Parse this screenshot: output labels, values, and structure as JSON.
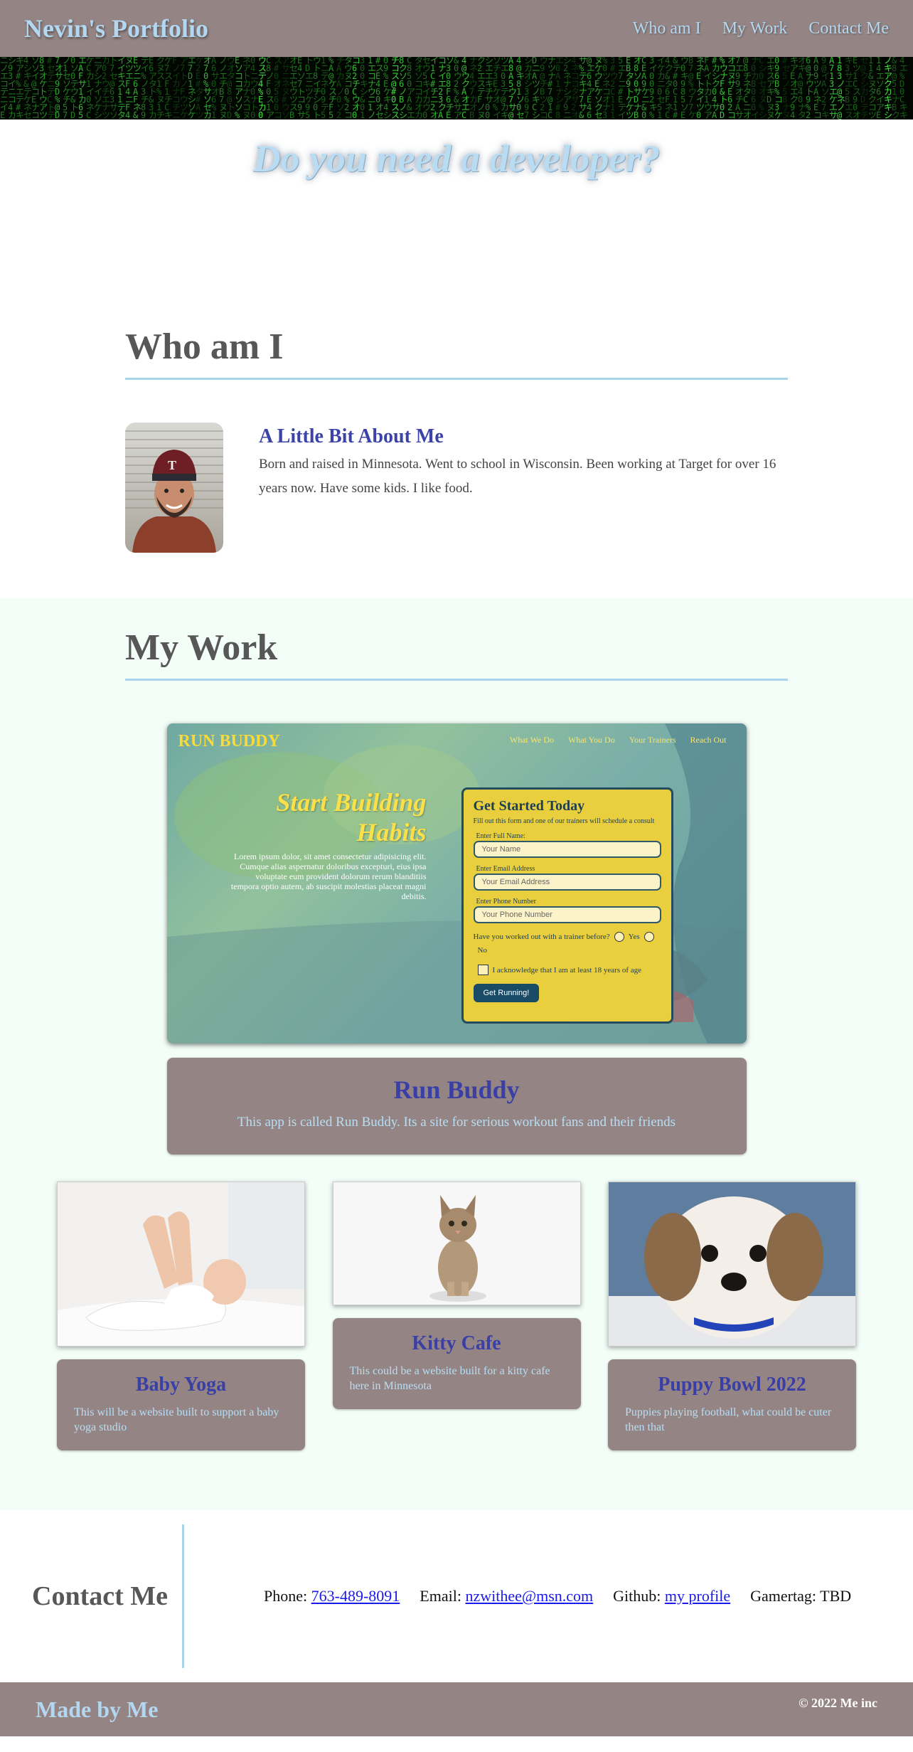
{
  "header": {
    "title": "Nevin's Portfolio",
    "nav": [
      "Who am I",
      "My Work",
      "Contact Me"
    ]
  },
  "hero": {
    "tagline": "Do you need a developer?"
  },
  "about": {
    "section_title": "Who am I",
    "heading": "A Little Bit About Me",
    "body": "Born and raised in Minnesota. Went to school in Wisconsin. Been working at Target for over 16 years now. Have some kids. I like food."
  },
  "work": {
    "section_title": "My Work",
    "featured": {
      "screenshot": {
        "logo": "RUN BUDDY",
        "nav": [
          "What We Do",
          "What You Do",
          "Your Trainers",
          "Reach Out"
        ],
        "headline": "Start Building Habits",
        "lorem": "Lorem ipsum dolor, sit amet consectetur adipisicing elit. Cumque alias aspernatur doloribus excepturi, eius ipsa voluptate eum provident dolorum rerum blanditiis tempora optio autem, ab suscipit molestias placeat magni debitis.",
        "form_title": "Get Started Today",
        "form_subtitle": "Fill out this form and one of our trainers will schedule a consult",
        "name_label": "Enter Full Name:",
        "name_placeholder": "Your Name",
        "email_label": "Enter Email Address",
        "email_placeholder": "Your Email Address",
        "phone_label": "Enter Phone Number",
        "phone_placeholder": "Your Phone Number",
        "question": "Have you worked out with a trainer before?",
        "yes": "Yes",
        "no": "No",
        "ack": "I acknowledge that I am at least 18 years of age",
        "button": "Get Running!"
      },
      "title": "Run Buddy",
      "description": "This app is called Run Buddy. Its a site for serious workout fans and their friends"
    },
    "projects": [
      {
        "title": "Baby Yoga",
        "description": "This will be a website built to support a baby yoga studio"
      },
      {
        "title": "Kitty Cafe",
        "description": "This could be a website built for a kitty cafe here in Minnesota"
      },
      {
        "title": "Puppy Bowl 2022",
        "description": "Puppies playing football, what could be cuter then that"
      }
    ]
  },
  "contact": {
    "title": "Contact Me",
    "phone_label": "Phone:",
    "phone": "763-489-8091",
    "email_label": "Email:",
    "email": "nzwithee@msn.com",
    "github_label": "Github:",
    "github": "my profile",
    "gamertag_label": "Gamertag:",
    "gamertag": "TBD"
  },
  "footer": {
    "made_by": "Made by Me",
    "copyright": "© 2022 Me inc"
  },
  "colors": {
    "header_bg": "#948584",
    "link_blue": "#b3d7f0",
    "card_title": "#3a3fa6",
    "work_bg": "#f4fef8"
  }
}
